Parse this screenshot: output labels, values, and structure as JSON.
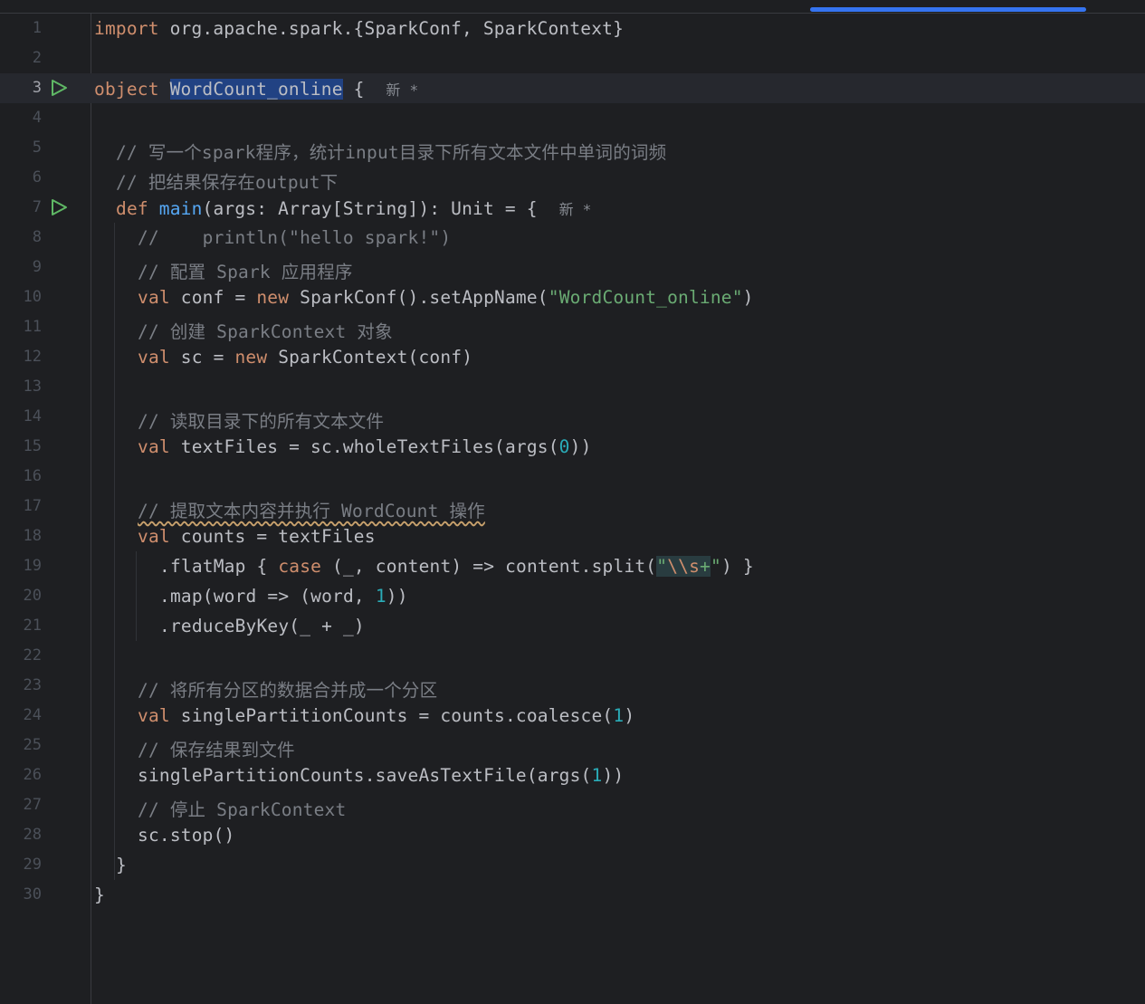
{
  "scrollbar": {
    "label": ""
  },
  "lines": [
    {
      "n": "1"
    },
    {
      "n": "2"
    },
    {
      "n": "3"
    },
    {
      "n": "4"
    },
    {
      "n": "5"
    },
    {
      "n": "6"
    },
    {
      "n": "7"
    },
    {
      "n": "8"
    },
    {
      "n": "9"
    },
    {
      "n": "10"
    },
    {
      "n": "11"
    },
    {
      "n": "12"
    },
    {
      "n": "13"
    },
    {
      "n": "14"
    },
    {
      "n": "15"
    },
    {
      "n": "16"
    },
    {
      "n": "17"
    },
    {
      "n": "18"
    },
    {
      "n": "19"
    },
    {
      "n": "20"
    },
    {
      "n": "21"
    },
    {
      "n": "22"
    },
    {
      "n": "23"
    },
    {
      "n": "24"
    },
    {
      "n": "25"
    },
    {
      "n": "26"
    },
    {
      "n": "27"
    },
    {
      "n": "28"
    },
    {
      "n": "29"
    },
    {
      "n": "30"
    }
  ],
  "code": {
    "l1": {
      "kw": "import",
      "rest": " org.apache.spark.{SparkConf, SparkContext}"
    },
    "l3": {
      "kw": "object",
      "name": "WordCount_online",
      "rest": " {",
      "hint": "新 *"
    },
    "l5": {
      "comment": "// 写一个spark程序，统计input目录下所有文本文件中单词的词频"
    },
    "l6": {
      "comment": "// 把结果保存在output下"
    },
    "l7": {
      "kw": "def",
      "fn": "main",
      "rest": "(args: Array[String]): Unit = {",
      "hint": "新 *"
    },
    "l8": {
      "comment": "//    println(\"hello spark!\")"
    },
    "l9": {
      "comment": "// 配置 Spark 应用程序"
    },
    "l10": {
      "kw": "val",
      "a": " conf = ",
      "kw2": "new",
      "b": " SparkConf().setAppName(",
      "str": "\"WordCount_online\"",
      "c": ")"
    },
    "l11": {
      "comment": "// 创建 SparkContext 对象"
    },
    "l12": {
      "kw": "val",
      "a": " sc = ",
      "kw2": "new",
      "b": " SparkContext(conf)"
    },
    "l14": {
      "comment": "// 读取目录下的所有文本文件"
    },
    "l15": {
      "kw": "val",
      "a": " textFiles = sc.wholeTextFiles(args(",
      "num": "0",
      "b": "))"
    },
    "l17": {
      "comment": "// 提取文本内容并执行 WordCount 操作"
    },
    "l18": {
      "kw": "val",
      "a": " counts = textFiles"
    },
    "l19": {
      "a": ".flatMap { ",
      "kw": "case",
      "b": " (_, content) => content.split(",
      "q1": "\"",
      "esc": "\\\\s",
      "plus": "+",
      "q2": "\"",
      "c": ") }"
    },
    "l20": {
      "a": ".map(word => (word, ",
      "num": "1",
      "b": "))"
    },
    "l21": {
      "a": ".reduceByKey(_ + _)"
    },
    "l23": {
      "comment": "// 将所有分区的数据合并成一个分区"
    },
    "l24": {
      "kw": "val",
      "a": " singlePartitionCounts = counts.coalesce(",
      "num": "1",
      "b": ")"
    },
    "l25": {
      "comment": "// 保存结果到文件"
    },
    "l26": {
      "a": "singlePartitionCounts.saveAsTextFile(args(",
      "num": "1",
      "b": "))"
    },
    "l27": {
      "comment": "// 停止 SparkContext"
    },
    "l28": {
      "a": "sc.stop()"
    },
    "l29": {
      "a": "}"
    },
    "l30": {
      "a": "}"
    }
  },
  "colors": {
    "background": "#1e1f22",
    "keyword": "#cf8e6d",
    "function": "#56a8f5",
    "string": "#6aab73",
    "number": "#2aacb8",
    "comment": "#7a7e85",
    "selection": "#214283",
    "run_icon": "#5fb865"
  },
  "icons": {
    "run": "run-gutter-icon"
  }
}
